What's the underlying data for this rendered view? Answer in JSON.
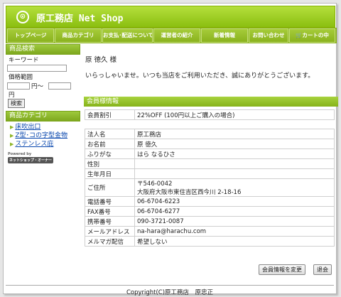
{
  "header": {
    "logo_glyph": "⊙",
    "shop_name": "原工務店 Net Shop"
  },
  "nav": [
    "トップページ",
    "商品カテゴリ",
    "お支払･配送について",
    "運営者の紹介",
    "新着情報",
    "お問い合わせ",
    "🛒カートの中"
  ],
  "sidebar": {
    "search_heading": "商品検索",
    "keyword_label": "キーワード",
    "price_label": "価格範囲",
    "yen_to": "円〜",
    "yen": "円",
    "search_button": "検索",
    "category_heading": "商品カテゴリ",
    "categories": [
      "床吹出口",
      "Z型･コの字型金物",
      "ステンレス庇"
    ],
    "powered_small": "Powered by",
    "powered_name": "ネットショップ・オーナー"
  },
  "greeting": {
    "name": "原 徳久 様",
    "message": "いらっしゃいませ。いつも当店をご利用いただき、誠にありがとうございます。"
  },
  "member": {
    "heading": "会員様情報",
    "discount_label": "会員割引",
    "discount_value": "22%OFF (100円以上ご購入の場合)",
    "rows": [
      {
        "k": "法人名",
        "v": "原工務店"
      },
      {
        "k": "お名前",
        "v": "原 徳久"
      },
      {
        "k": "ふりがな",
        "v": "はら なるひさ"
      },
      {
        "k": "性別",
        "v": ""
      },
      {
        "k": "生年月日",
        "v": ""
      },
      {
        "k": "ご住所",
        "v": "〒546-0042",
        "v2": "大阪府大阪市東住吉区西今川 2-18-16"
      },
      {
        "k": "電話番号",
        "v": "06-6704-6223"
      },
      {
        "k": "FAX番号",
        "v": "06-6704-6277"
      },
      {
        "k": "携帯番号",
        "v": "090-3721-0087"
      },
      {
        "k": "メールアドレス",
        "v": "na-hara@harachu.com"
      },
      {
        "k": "メルマガ配信",
        "v": "希望しない"
      }
    ],
    "change_button": "会員情報を変更",
    "withdraw_button": "退会"
  },
  "footer": {
    "copyright": "Copyright(C)原工務店　原忠正"
  }
}
